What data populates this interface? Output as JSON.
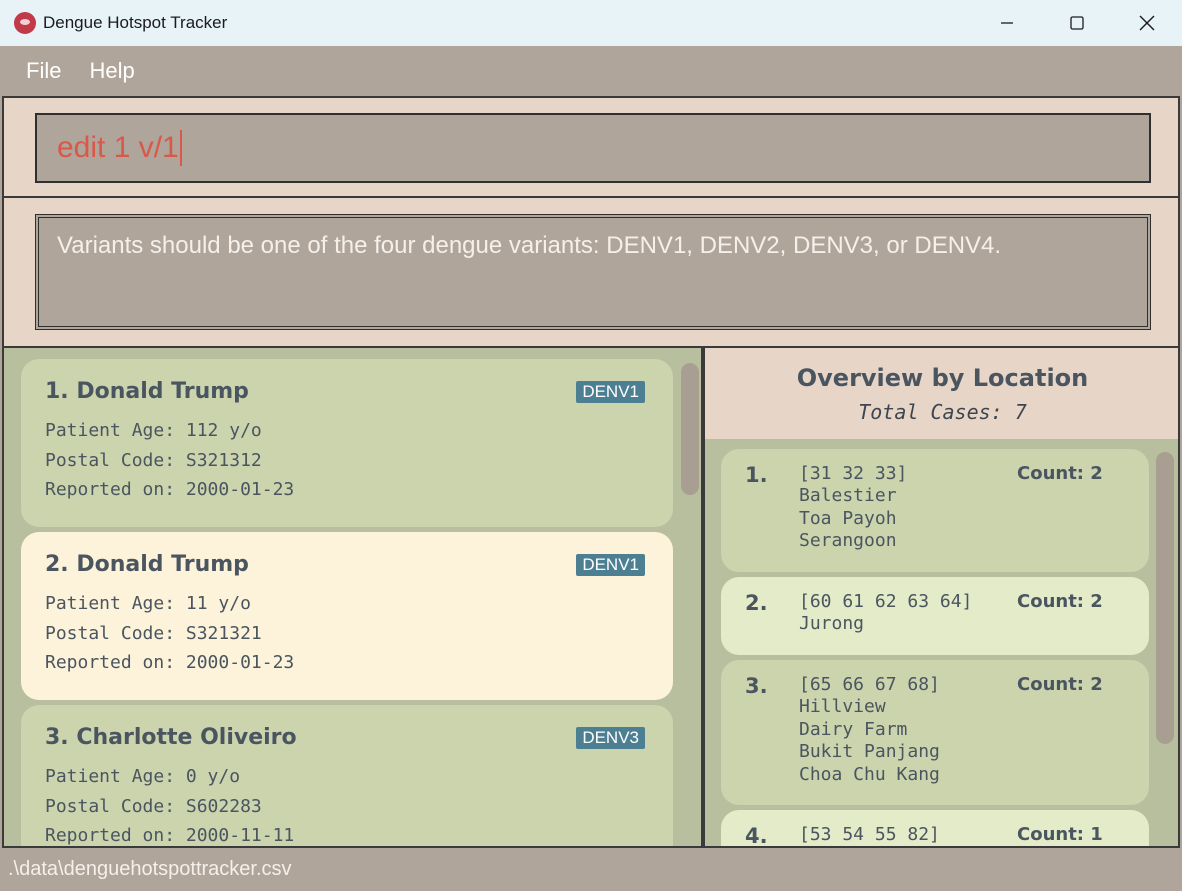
{
  "window": {
    "title": "Dengue Hotspot Tracker",
    "icon": "app-logo-icon",
    "controls": [
      "minimize-icon",
      "maximize-icon",
      "close-icon"
    ]
  },
  "menu": {
    "file": "File",
    "help": "Help"
  },
  "command": {
    "value": "edit 1 v/1"
  },
  "result": {
    "message": "Variants should be one of the four dengue variants: DENV1, DENV2, DENV3, or DENV4."
  },
  "cases": [
    {
      "title": "1. Donald Trump",
      "variant": "DENV1",
      "age": "Patient Age: 112 y/o",
      "postal": "Postal Code: S321312",
      "date": "Reported on: 2000-01-23"
    },
    {
      "title": "2. Donald Trump",
      "variant": "DENV1",
      "age": "Patient Age: 11 y/o",
      "postal": "Postal Code: S321321",
      "date": "Reported on: 2000-01-23"
    },
    {
      "title": "3. Charlotte Oliveiro",
      "variant": "DENV3",
      "age": "Patient Age: 0 y/o",
      "postal": "Postal Code: S602283",
      "date": "Reported on: 2000-11-11"
    }
  ],
  "overview": {
    "title": "Overview by Location",
    "total": "Total Cases: 7",
    "items": [
      {
        "index": "1.",
        "ids": "[31 32 33]",
        "count": "Count: 2",
        "names": [
          "Balestier",
          "Toa Payoh",
          "Serangoon"
        ]
      },
      {
        "index": "2.",
        "ids": "[60 61 62 63 64]",
        "count": "Count: 2",
        "names": [
          "Jurong"
        ]
      },
      {
        "index": "3.",
        "ids": "[65 66 67 68]",
        "count": "Count: 2",
        "names": [
          "Hillview",
          "Dairy Farm",
          "Bukit Panjang",
          "Choa Chu Kang"
        ]
      },
      {
        "index": "4.",
        "ids": "[53 54 55 82]",
        "count": "Count: 1",
        "names": []
      }
    ]
  },
  "status": {
    "path": ".\\data\\denguehotspottracker.csv"
  },
  "colors": {
    "accent_command": "#d9584a",
    "variant_tag": "#4d7f93",
    "card": "#cbd4ad",
    "card_selected": "#fdf3da",
    "panel": "#b0a59a",
    "header": "#e7d6c8"
  }
}
